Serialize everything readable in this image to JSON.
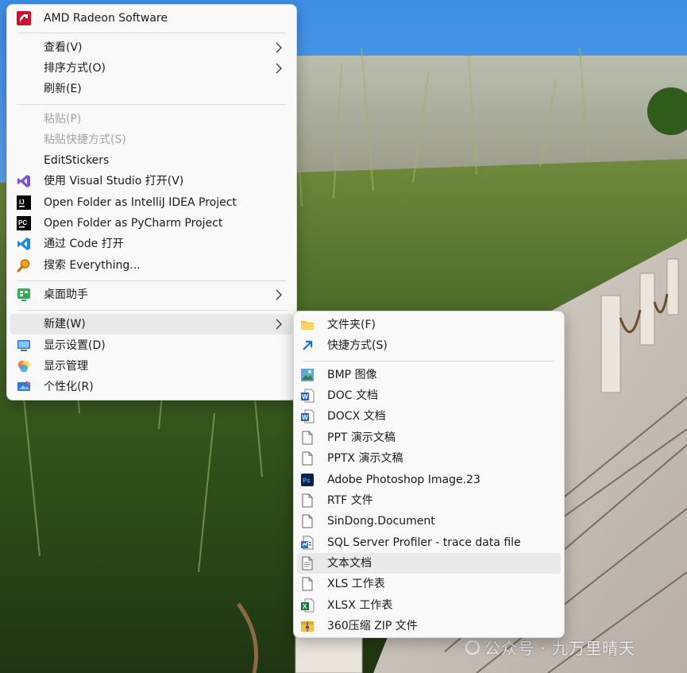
{
  "main_menu": {
    "items": [
      {
        "label": "AMD Radeon Software",
        "icon": "amd-icon"
      },
      {
        "label": "查看(V)",
        "submenu": true
      },
      {
        "label": "排序方式(O)",
        "submenu": true
      },
      {
        "label": "刷新(E)"
      },
      {
        "label": "粘贴(P)",
        "disabled": true
      },
      {
        "label": "粘贴快捷方式(S)",
        "disabled": true
      },
      {
        "label": "EditStickers"
      },
      {
        "label": "使用 Visual Studio 打开(V)",
        "icon": "visual-studio-icon"
      },
      {
        "label": "Open Folder as IntelliJ IDEA Project",
        "icon": "intellij-icon"
      },
      {
        "label": "Open Folder as PyCharm Project",
        "icon": "pycharm-icon"
      },
      {
        "label": "通过 Code 打开",
        "icon": "vscode-icon"
      },
      {
        "label": "搜索 Everything...",
        "icon": "everything-icon"
      },
      {
        "label": "桌面助手",
        "icon": "desktop-assistant-icon",
        "submenu": true
      },
      {
        "label": "新建(W)",
        "submenu": true,
        "highlighted": true
      },
      {
        "label": "显示设置(D)",
        "icon": "display-settings-icon"
      },
      {
        "label": "显示管理",
        "icon": "display-manager-icon"
      },
      {
        "label": "个性化(R)",
        "icon": "personalize-icon"
      }
    ]
  },
  "new_submenu": {
    "items": [
      {
        "label": "文件夹(F)",
        "icon": "folder-icon"
      },
      {
        "label": "快捷方式(S)",
        "icon": "shortcut-icon"
      },
      {
        "label": "BMP 图像",
        "icon": "bmp-image-icon"
      },
      {
        "label": "DOC 文档",
        "icon": "word-doc-icon"
      },
      {
        "label": "DOCX 文档",
        "icon": "word-docx-icon"
      },
      {
        "label": "PPT 演示文稿",
        "icon": "blank-file-icon"
      },
      {
        "label": "PPTX 演示文稿",
        "icon": "blank-file-icon"
      },
      {
        "label": "Adobe Photoshop Image.23",
        "icon": "photoshop-icon"
      },
      {
        "label": "RTF 文件",
        "icon": "blank-file-icon"
      },
      {
        "label": "SinDong.Document",
        "icon": "blank-file-icon"
      },
      {
        "label": "SQL Server Profiler - trace data file",
        "icon": "sql-profiler-icon"
      },
      {
        "label": "文本文档",
        "icon": "text-file-icon",
        "highlighted": true
      },
      {
        "label": "XLS 工作表",
        "icon": "blank-file-icon"
      },
      {
        "label": "XLSX 工作表",
        "icon": "excel-icon"
      },
      {
        "label": "360压缩 ZIP 文件",
        "icon": "zip-archive-icon"
      }
    ]
  },
  "watermark": {
    "text": "公众号 · 九万里晴天"
  },
  "colors": {
    "menu_bg": "#f9f9f9",
    "highlight": "#e9e9e9",
    "disabled_text": "#a3a3a3",
    "sky": "#5aa0ea",
    "boardwalk": "#c9c2b8"
  }
}
